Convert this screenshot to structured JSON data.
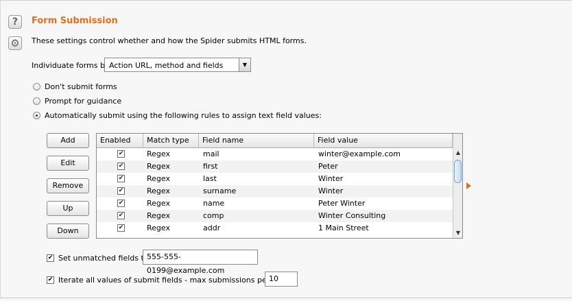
{
  "title": "Form Submission",
  "description": "These settings control whether and how the Spider submits HTML forms.",
  "individuate": {
    "label": "Individuate forms by:",
    "selected": "Action URL, method and fields"
  },
  "options": [
    {
      "label": "Don't submit forms",
      "selected": false
    },
    {
      "label": "Prompt for guidance",
      "selected": false
    },
    {
      "label": "Automatically submit using the following rules to assign text field values:",
      "selected": true
    }
  ],
  "buttons": [
    "Add",
    "Edit",
    "Remove",
    "Up",
    "Down"
  ],
  "table": {
    "columns": [
      "Enabled",
      "Match type",
      "Field name",
      "Field value"
    ],
    "rows": [
      {
        "enabled": true,
        "match": "Regex",
        "name": "mail",
        "value": "winter@example.com"
      },
      {
        "enabled": true,
        "match": "Regex",
        "name": "first",
        "value": "Peter"
      },
      {
        "enabled": true,
        "match": "Regex",
        "name": "last",
        "value": "Winter"
      },
      {
        "enabled": true,
        "match": "Regex",
        "name": "surname",
        "value": "Winter"
      },
      {
        "enabled": true,
        "match": "Regex",
        "name": "name",
        "value": "Peter Winter"
      },
      {
        "enabled": true,
        "match": "Regex",
        "name": "comp",
        "value": "Winter Consulting"
      },
      {
        "enabled": true,
        "match": "Regex",
        "name": "addr",
        "value": "1 Main Street"
      }
    ]
  },
  "unmatched": {
    "checked": true,
    "label": "Set unmatched fields to:",
    "value": "555-555-0199@example.com"
  },
  "iterate": {
    "checked": true,
    "label": "Iterate all values of submit fields - max submissions per form:",
    "value": "10"
  },
  "colors": {
    "accent": "#e07020"
  }
}
